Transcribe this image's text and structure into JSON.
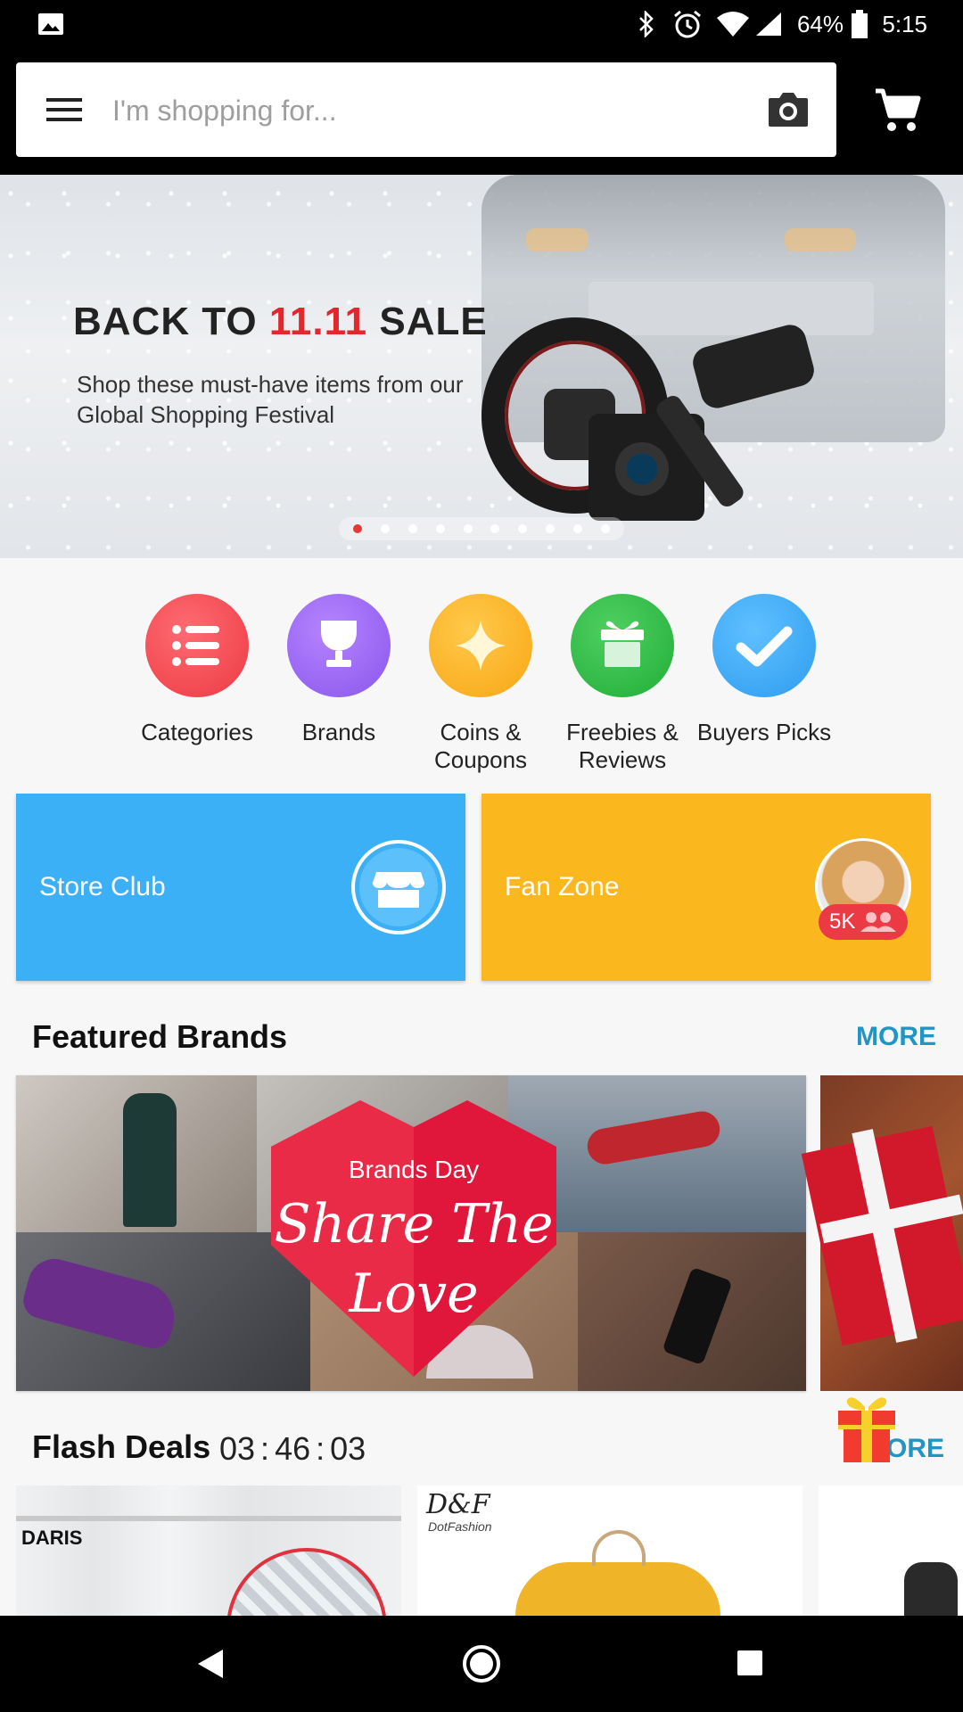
{
  "status_bar": {
    "battery": "64%",
    "time": "5:15",
    "icons": [
      "image-icon",
      "bluetooth-icon",
      "alarm-icon",
      "wifi-icon",
      "signal-icon",
      "battery-icon"
    ]
  },
  "header": {
    "search_placeholder": "I'm shopping for...",
    "icons": [
      "menu-icon",
      "camera-icon",
      "cart-icon"
    ]
  },
  "banner": {
    "title_prefix": "BACK TO ",
    "title_highlight": "11.11",
    "title_suffix": " SALE",
    "subtitle": "Shop these must-have items from our Global Shopping Festival",
    "dot_count": 10,
    "active_dot": 1,
    "highlight_color": "#e4262d"
  },
  "quick_links": [
    {
      "label": "Categories",
      "icon": "list-icon",
      "color": "#f0444c"
    },
    {
      "label": "Brands",
      "icon": "trophy-icon",
      "color": "#9a63f0"
    },
    {
      "label": "Coins & Coupons",
      "icon": "sparkle-icon",
      "color": "#fbb023"
    },
    {
      "label": "Freebies & Reviews",
      "icon": "gift-icon",
      "color": "#2fbd45"
    },
    {
      "label": "Buyers Picks",
      "icon": "check-icon",
      "color": "#3aa6f5"
    }
  ],
  "cards": {
    "store_club": {
      "label": "Store Club",
      "color": "#3cb0f7"
    },
    "fan_zone": {
      "label": "Fan Zone",
      "color": "#fbb81e",
      "badge": "5K"
    }
  },
  "featured_brands": {
    "title": "Featured Brands",
    "more": "MORE",
    "banner_kicker": "Brands Day",
    "banner_line1": "Share The",
    "banner_line2": "Love"
  },
  "flash_deals": {
    "title": "Flash Deals",
    "timer_h": "03",
    "timer_m": "46",
    "timer_s": "03",
    "sep": ":",
    "more_partial": "ORE",
    "products": [
      {
        "brand": "DARIS"
      },
      {
        "brand": "D&F",
        "brand_sub": "DotFashion"
      }
    ]
  }
}
